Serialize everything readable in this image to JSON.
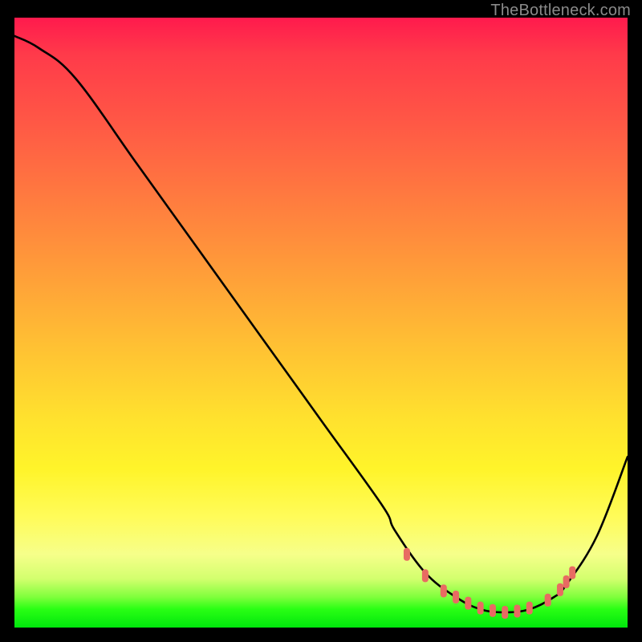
{
  "watermark": {
    "text": "TheBottleneck.com"
  },
  "chart_data": {
    "type": "line",
    "title": "",
    "xlabel": "",
    "ylabel": "",
    "xlim": [
      0,
      100
    ],
    "ylim": [
      0,
      100
    ],
    "grid": false,
    "legend": false,
    "series": [
      {
        "name": "bottleneck-curve",
        "x": [
          0,
          4,
          10,
          20,
          30,
          40,
          50,
          60,
          62,
          67,
          72,
          76,
          80,
          84,
          88,
          90,
          95,
          100
        ],
        "values": [
          97,
          95,
          90,
          76,
          62,
          48,
          34,
          20,
          16,
          9,
          5,
          3,
          2.5,
          3,
          5,
          7,
          15,
          28
        ]
      }
    ],
    "markers": {
      "name": "optimal-range-markers",
      "color": "#e86b62",
      "points": [
        {
          "x": 64,
          "y": 12
        },
        {
          "x": 67,
          "y": 8.5
        },
        {
          "x": 70,
          "y": 6
        },
        {
          "x": 72,
          "y": 5
        },
        {
          "x": 74,
          "y": 4
        },
        {
          "x": 76,
          "y": 3.2
        },
        {
          "x": 78,
          "y": 2.8
        },
        {
          "x": 80,
          "y": 2.5
        },
        {
          "x": 82,
          "y": 2.7
        },
        {
          "x": 84,
          "y": 3.2
        },
        {
          "x": 87,
          "y": 4.5
        },
        {
          "x": 89,
          "y": 6.2
        },
        {
          "x": 90,
          "y": 7.5
        },
        {
          "x": 91,
          "y": 9
        }
      ]
    }
  }
}
